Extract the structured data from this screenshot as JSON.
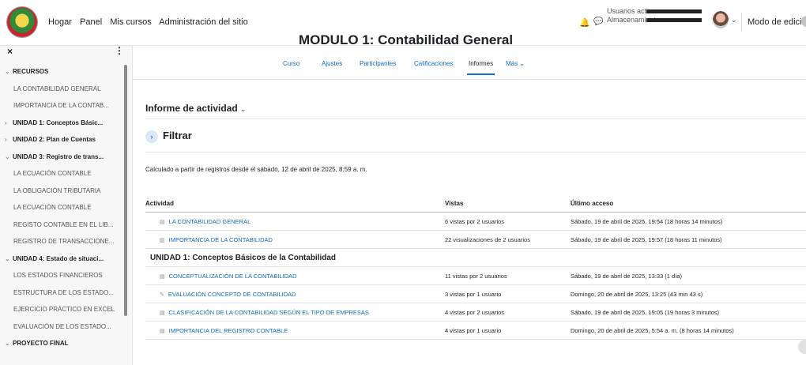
{
  "navbar": {
    "links": [
      "Hogar",
      "Panel",
      "Mis cursos",
      "Administración del sitio"
    ],
    "stats": {
      "active_users_label": "Usuarios activos",
      "storage_label": "Almacenamiento"
    },
    "edit_mode_label": "Modo de edición",
    "icons": [
      "bell-icon",
      "chat-icon",
      "chevron-down-icon"
    ]
  },
  "drawer": {
    "items": [
      {
        "type": "section",
        "expanded": true,
        "label": "RECURSOS"
      },
      {
        "type": "item",
        "label": "LA CONTABILIDAD GENERAL"
      },
      {
        "type": "item",
        "label": "IMPORTANCIA DE LA CONTAB..."
      },
      {
        "type": "section",
        "expanded": false,
        "label": "UNIDAD 1: Conceptos Básic..."
      },
      {
        "type": "section",
        "expanded": false,
        "label": "UNIDAD 2: Plan de Cuentas"
      },
      {
        "type": "section",
        "expanded": true,
        "label": "UNIDAD 3: Registro de trans..."
      },
      {
        "type": "item",
        "label": "LA ECUACIÓN CONTABLE"
      },
      {
        "type": "item",
        "label": "LA OBLIGACIÓN TRIBUTARIA"
      },
      {
        "type": "item",
        "label": "LA ECUACIÓN CONTABLE"
      },
      {
        "type": "item",
        "label": "REGISTO CONTABLE EN EL LIB..."
      },
      {
        "type": "item",
        "label": "REGISTRO DE TRANSACCIONE..."
      },
      {
        "type": "section",
        "expanded": true,
        "label": "UNIDAD 4: Estado de situaci..."
      },
      {
        "type": "item",
        "label": "LOS ESTADOS FINANCIEROS"
      },
      {
        "type": "item",
        "label": "ESTRUCTURA DE LOS ESTADO..."
      },
      {
        "type": "item",
        "label": "EJERCICIO PRÁCTICO EN EXCEL"
      },
      {
        "type": "item",
        "label": "EVALUACIÓN DE LOS ESTADO..."
      },
      {
        "type": "section",
        "expanded": true,
        "label": "PROYECTO FINAL"
      }
    ]
  },
  "main": {
    "course_title": "MODULO 1: Contabilidad General",
    "tabs": [
      "Curso",
      "Ajustes",
      "Participantes",
      "Calificaciones",
      "Informes",
      "Más"
    ],
    "active_tab": "Informes",
    "report_title": "Informe de actividad",
    "filter_label": "Filtrar",
    "calc_note": "Calculado a partir de registros desde el sábado, 12 de abril de 2025, 8:59 a. m.",
    "table": {
      "headers": [
        "Actividad",
        "Vistas",
        "Último acceso"
      ],
      "rows": [
        {
          "type": "row",
          "icon": "page-icon",
          "activity": "LA CONTABILIDAD GENERAL",
          "views": "6 vistas por 2 usuarios",
          "last": "Sábado, 19 de abril de 2025, 19:54 (18 horas 14 minutos)"
        },
        {
          "type": "row",
          "icon": "book-icon",
          "activity": "IMPORTANCIA DE LA CONTABILIDAD",
          "views": "22 visualizaciones de 2 usuarios",
          "last": "Sábado, 19 de abril de 2025, 19:57 (18 horas 11 minutos)"
        },
        {
          "type": "group",
          "label": "UNIDAD 1: Conceptos Básicos de la Contabilidad"
        },
        {
          "type": "row",
          "icon": "page-icon",
          "activity": "CONCEPTUALIZACIÓN DE LA CONTABILIDAD",
          "views": "11 vistas por 2 usuarios",
          "last": "Sábado, 19 de abril de 2025, 13:33 (1 día)"
        },
        {
          "type": "row",
          "icon": "quiz-icon",
          "activity": "EVALUACIÓN CONCEPTO DE CONTABILIDAD",
          "views": "3 vistas por 1 usuario",
          "last": "Domingo, 20 de abril de 2025, 13:25 (43 min 43 s)"
        },
        {
          "type": "row",
          "icon": "page-icon",
          "activity": "CLASIFICACIÓN DE LA CONTABILIDAD SEGÚN EL TIPO DE EMPRESAS",
          "views": "4 vistas por 2 usuarios",
          "last": "Sábado, 19 de abril de 2025, 19:05 (19 horas 3 minutos)"
        },
        {
          "type": "row",
          "icon": "page-icon",
          "activity": "IMPORTANCIA DEL REGISTRO CONTABLE",
          "views": "4 vistas por 1 usuario",
          "last": "Domingo, 20 de abril de 2025, 5:54 a. m. (8 horas 14 minutos)"
        }
      ]
    }
  },
  "colors": {
    "link": "#0f6cbf",
    "text": "#1d2125",
    "drawer_bg": "#f7f7f8"
  }
}
